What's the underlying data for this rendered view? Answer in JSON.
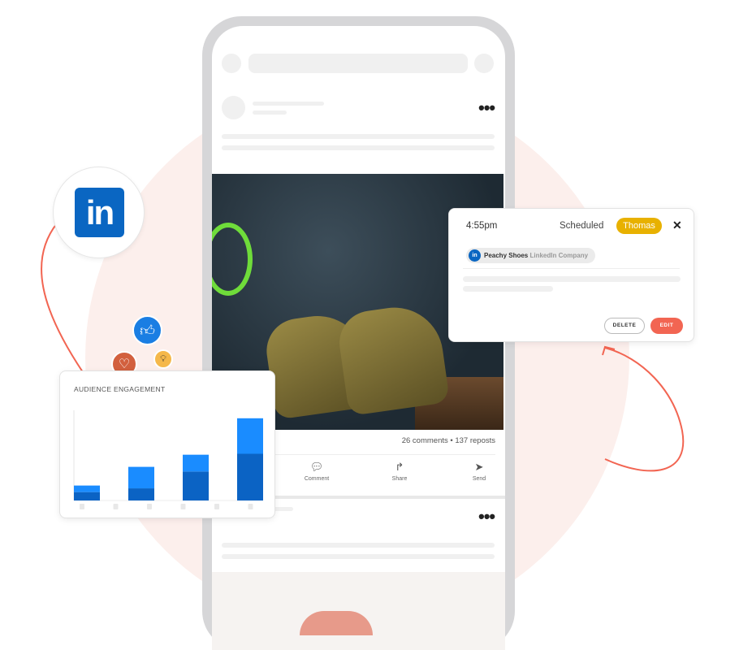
{
  "brand": {
    "linkedin_logo": "in",
    "accent": "#0a66c2",
    "arrow_color": "#f26552"
  },
  "post": {
    "stats": "26 comments • 137 reposts",
    "actions": [
      {
        "label": "Comment",
        "icon": "comment-icon"
      },
      {
        "label": "Share",
        "icon": "share-icon"
      },
      {
        "label": "Send",
        "icon": "send-icon"
      }
    ]
  },
  "schedule": {
    "time": "4:55pm",
    "status": "Scheduled",
    "assignee": "Thomas",
    "assignee_color": "#e8b100",
    "account_name": "Peachy Shoes",
    "account_type": "LinkedIn Company",
    "delete_label": "DELETE",
    "edit_label": "EDIT",
    "edit_color": "#f26552"
  },
  "reactions": [
    {
      "icon": "thumbs-up-icon",
      "color": "#1a7ee3"
    },
    {
      "icon": "heart-icon",
      "color": "#d2603e"
    },
    {
      "icon": "lightbulb-icon",
      "color": "#f5b84a"
    }
  ],
  "chart_data": {
    "type": "bar",
    "stacked": true,
    "title": "AUDIENCE ENGAGEMENT",
    "categories": [
      "",
      "",
      "",
      ""
    ],
    "ylim": [
      0,
      100
    ],
    "series": [
      {
        "values": [
          9,
          13,
          31,
          50
        ],
        "color": "#0b63c4"
      },
      {
        "values": [
          7,
          23,
          18,
          38
        ],
        "color": "#1a8cff"
      }
    ]
  }
}
